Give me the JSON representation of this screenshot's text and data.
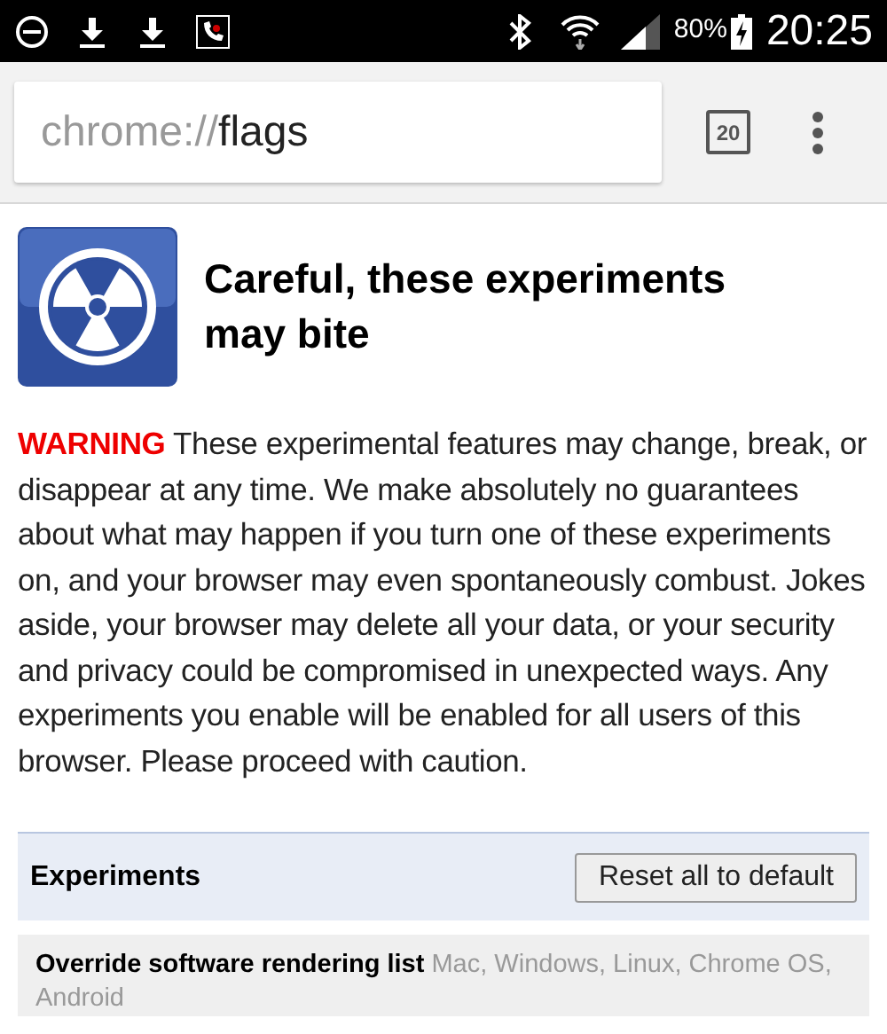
{
  "status_bar": {
    "time": "20:25",
    "battery": "80%"
  },
  "toolbar": {
    "url_scheme": "chrome://",
    "url_path": "flags",
    "tab_count": "20"
  },
  "header": {
    "title": "Careful, these experiments may bite"
  },
  "warning": {
    "label": "WARNING",
    "text": "These experimental features may change, break, or disappear at any time. We make absolutely no guarantees about what may happen if you turn one of these experiments on, and your browser may even spontaneously combust. Jokes aside, your browser may delete all your data, or your security and privacy could be compromised in unexpected ways. Any experiments you enable will be enabled for all users of this browser. Please proceed with caution."
  },
  "experiments": {
    "title": "Experiments",
    "reset_button": "Reset all to default",
    "items": [
      {
        "name": "Override software rendering list",
        "platforms": "Mac, Windows, Linux, Chrome OS, Android"
      }
    ]
  }
}
